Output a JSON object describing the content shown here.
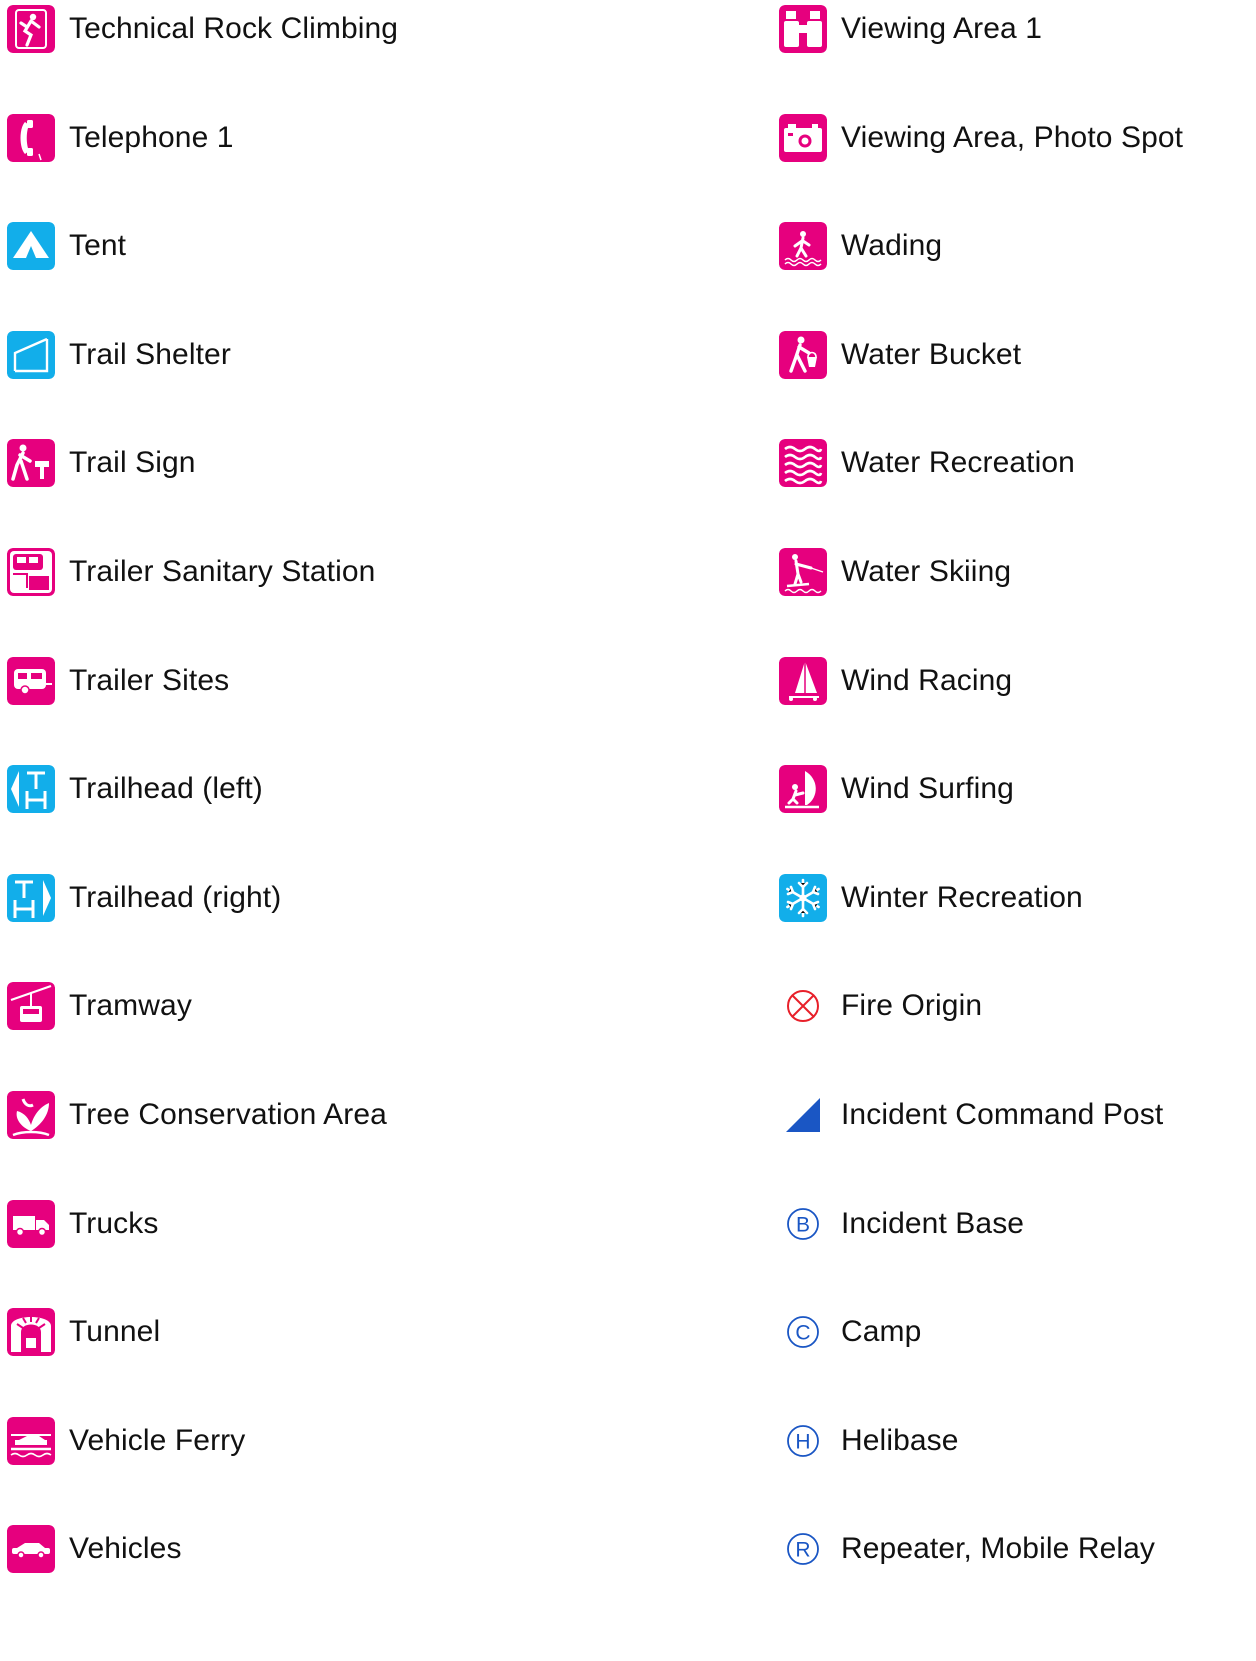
{
  "colors": {
    "magenta": "#e6007e",
    "cyan": "#12aeea",
    "incident_blue": "#1a56c4",
    "fire_red": "#e8202a"
  },
  "legend": {
    "left": [
      {
        "label": "Technical Rock Climbing",
        "icon": "rock-climbing-icon",
        "color": "magenta"
      },
      {
        "label": "Telephone 1",
        "icon": "telephone-icon",
        "color": "magenta"
      },
      {
        "label": "Tent",
        "icon": "tent-icon",
        "color": "cyan"
      },
      {
        "label": "Trail Shelter",
        "icon": "trail-shelter-icon",
        "color": "cyan"
      },
      {
        "label": "Trail Sign",
        "icon": "trail-sign-icon",
        "color": "magenta"
      },
      {
        "label": "Trailer Sanitary Station",
        "icon": "trailer-sanitary-station-icon",
        "color": "magenta"
      },
      {
        "label": "Trailer Sites",
        "icon": "trailer-sites-icon",
        "color": "magenta"
      },
      {
        "label": "Trailhead (left)",
        "icon": "trailhead-left-icon",
        "color": "cyan"
      },
      {
        "label": "Trailhead (right)",
        "icon": "trailhead-right-icon",
        "color": "cyan"
      },
      {
        "label": "Tramway",
        "icon": "tramway-icon",
        "color": "magenta"
      },
      {
        "label": "Tree Conservation Area",
        "icon": "tree-conservation-icon",
        "color": "magenta"
      },
      {
        "label": "Trucks",
        "icon": "truck-icon",
        "color": "magenta"
      },
      {
        "label": "Tunnel",
        "icon": "tunnel-icon",
        "color": "magenta"
      },
      {
        "label": "Vehicle Ferry",
        "icon": "vehicle-ferry-icon",
        "color": "magenta"
      },
      {
        "label": "Vehicles",
        "icon": "car-icon",
        "color": "magenta"
      }
    ],
    "right": [
      {
        "label": "Viewing Area 1",
        "icon": "binoculars-icon",
        "color": "magenta"
      },
      {
        "label": "Viewing Area, Photo Spot",
        "icon": "camera-icon",
        "color": "magenta"
      },
      {
        "label": "Wading",
        "icon": "wading-icon",
        "color": "magenta"
      },
      {
        "label": "Water Bucket",
        "icon": "water-bucket-icon",
        "color": "magenta"
      },
      {
        "label": "Water Recreation",
        "icon": "water-waves-icon",
        "color": "magenta"
      },
      {
        "label": "Water Skiing",
        "icon": "water-skiing-icon",
        "color": "magenta"
      },
      {
        "label": "Wind Racing",
        "icon": "wind-racing-icon",
        "color": "magenta"
      },
      {
        "label": "Wind Surfing",
        "icon": "wind-surfing-icon",
        "color": "magenta"
      },
      {
        "label": "Winter Recreation",
        "icon": "snowflake-icon",
        "color": "cyan"
      },
      {
        "label": "Fire Origin",
        "icon": "circled-x-icon",
        "color": "fire_red"
      },
      {
        "label": "Incident Command Post",
        "icon": "command-post-triangle-icon",
        "color": "incident_blue"
      },
      {
        "label": "Incident Base",
        "icon": "circled-b-icon",
        "color": "incident_blue"
      },
      {
        "label": "Camp",
        "icon": "circled-c-icon",
        "color": "incident_blue"
      },
      {
        "label": "Helibase",
        "icon": "circled-h-icon",
        "color": "incident_blue"
      },
      {
        "label": "Repeater, Mobile Relay",
        "icon": "circled-r-icon",
        "color": "incident_blue"
      }
    ]
  }
}
